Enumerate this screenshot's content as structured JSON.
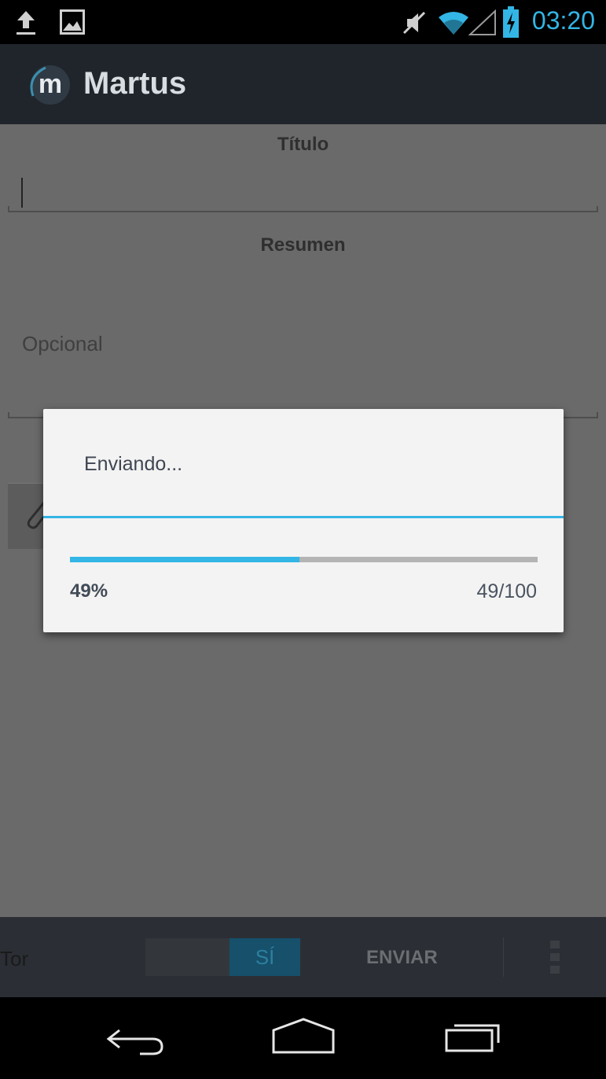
{
  "status_bar": {
    "time": "03:20",
    "icons": [
      "upload-icon",
      "image-icon",
      "mute-icon",
      "wifi-icon",
      "signal-icon",
      "battery-charging-icon"
    ]
  },
  "action_bar": {
    "logo_letter": "m",
    "title": "Martus"
  },
  "form": {
    "title_label": "Título",
    "title_value": "",
    "summary_label": "Resumen",
    "summary_placeholder": "Opcional",
    "attach_icon": "paperclip-icon"
  },
  "dialog": {
    "title": "Enviando...",
    "progress_percent_text": "49%",
    "progress_count_text": "49/100",
    "progress_fraction": 0.49
  },
  "bottom_bar": {
    "tor_label": "Tor",
    "toggle_on_label": "SÍ",
    "send_label": "ENVIAR",
    "overflow_icon": "overflow-menu-icon"
  },
  "nav_bar": {
    "icons": [
      "back-icon",
      "home-icon",
      "recent-apps-icon"
    ]
  },
  "colors": {
    "accent": "#33b5e5",
    "action_bar": "#20252c",
    "dialog_bg": "#f3f3f3",
    "scrim_content": "#6a6a6a"
  }
}
